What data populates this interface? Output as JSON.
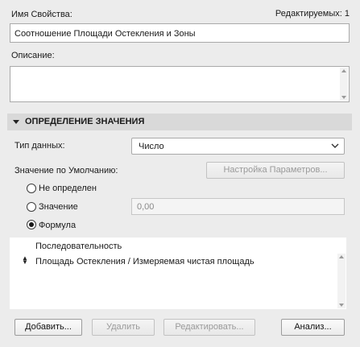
{
  "property": {
    "name_label": "Имя Свойства:",
    "editable_count": "Редактируемых: 1",
    "name_value": "Соотношение Площади Остекления и Зоны",
    "description_label": "Описание:",
    "description_value": ""
  },
  "value_definition": {
    "section_title": "ОПРЕДЕЛЕНИЕ ЗНАЧЕНИЯ",
    "data_type_label": "Тип данных:",
    "data_type_value": "Число",
    "default_label": "Значение по Умолчанию:",
    "params_button": "Настройка Параметров...",
    "options": {
      "undefined": "Не определен",
      "value": "Значение",
      "formula": "Формула"
    },
    "selected_option": "formula",
    "value_field": "0,00"
  },
  "sequence": {
    "header": "Последовательность",
    "rows": [
      "Площадь Остекления / Измеряемая чистая площадь"
    ]
  },
  "buttons": {
    "add": "Добавить...",
    "delete": "Удалить",
    "edit": "Редактировать...",
    "analysis": "Анализ..."
  },
  "colors": {
    "background": "#ececec",
    "section_bar": "#d9d9d9",
    "disabled_text": "#9a9a9a"
  }
}
